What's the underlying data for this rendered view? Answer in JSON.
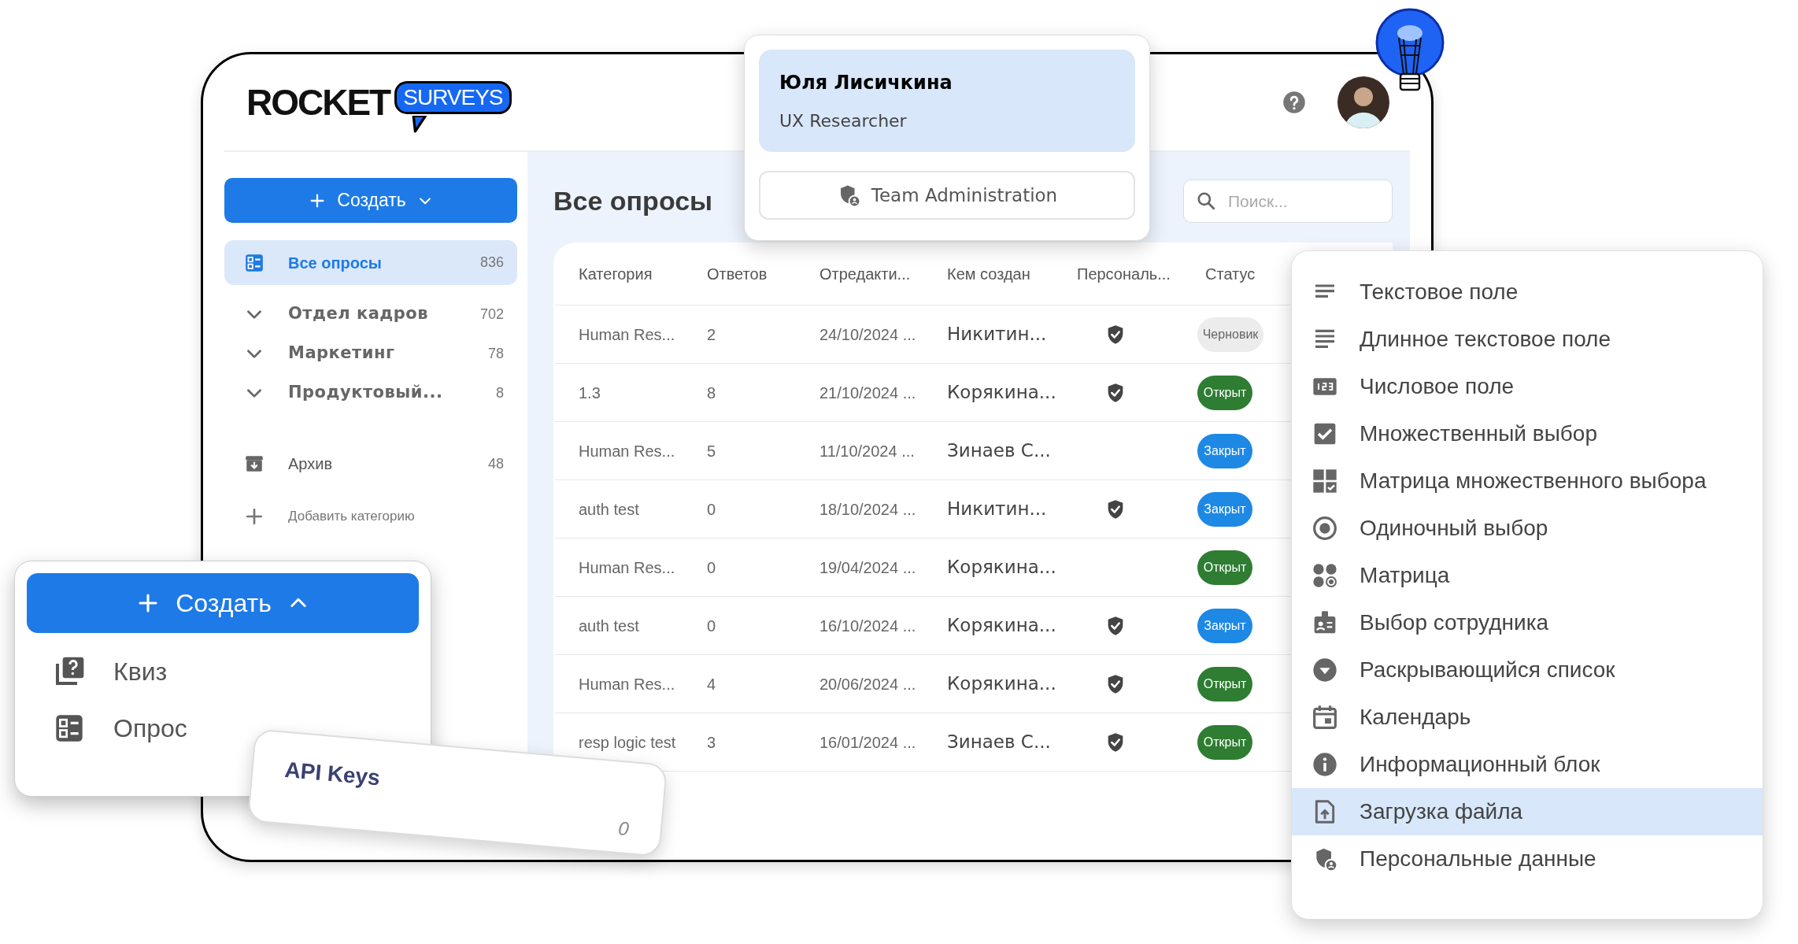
{
  "logo": {
    "word": "ROCKET",
    "badge": "SURVEYS"
  },
  "sidebar": {
    "create_button": {
      "label": "Создать",
      "expanded": false
    },
    "items": [
      {
        "kind": "all",
        "label": "Все опросы",
        "count": "836",
        "selected": true
      },
      {
        "kind": "folder",
        "label": "Отдел кадров",
        "count": "702",
        "selected": false
      },
      {
        "kind": "folder",
        "label": "Маркетинг",
        "count": "78",
        "selected": false
      },
      {
        "kind": "folder",
        "label": "Продуктовый...",
        "count": "8",
        "selected": false
      },
      {
        "kind": "archive",
        "label": "Архив",
        "count": "48",
        "selected": false
      }
    ],
    "add_category": "Добавить категорию"
  },
  "page_title": "Все опросы",
  "search": {
    "placeholder": "Поиск..."
  },
  "table": {
    "columns": [
      "Категория",
      "Ответов",
      "Отредакти...",
      "Кем создан",
      "Персональ...",
      "Статус"
    ],
    "rows": [
      {
        "cells": [
          "Human Res...",
          "2",
          "24/10/2024 ...",
          "Никитин..."
        ],
        "personal": true,
        "status": {
          "label": "Черновик",
          "kind": "draft"
        }
      },
      {
        "cells": [
          "1.3",
          "8",
          "21/10/2024 ...",
          "Корякина..."
        ],
        "personal": true,
        "status": {
          "label": "Открыт",
          "kind": "open"
        }
      },
      {
        "cells": [
          "Human Res...",
          "5",
          "11/10/2024 ...",
          "Зинаев С..."
        ],
        "personal": false,
        "status": {
          "label": "Закрыт",
          "kind": "closed"
        }
      },
      {
        "cells": [
          "auth test",
          "0",
          "18/10/2024 ...",
          "Никитин..."
        ],
        "personal": true,
        "status": {
          "label": "Закрыт",
          "kind": "closed"
        }
      },
      {
        "cells": [
          "Human Res...",
          "0",
          "19/04/2024 ...",
          "Корякина..."
        ],
        "personal": false,
        "status": {
          "label": "Открыт",
          "kind": "open"
        }
      },
      {
        "cells": [
          "auth test",
          "0",
          "16/10/2024 ...",
          "Корякина..."
        ],
        "personal": true,
        "status": {
          "label": "Закрыт",
          "kind": "closed"
        }
      },
      {
        "cells": [
          "Human Res...",
          "4",
          "20/06/2024 ...",
          "Корякина..."
        ],
        "personal": true,
        "status": {
          "label": "Открыт",
          "kind": "open"
        }
      },
      {
        "cells": [
          "resp logic test",
          "3",
          "16/01/2024 ...",
          "Зинаев С..."
        ],
        "personal": true,
        "status": {
          "label": "Открыт",
          "kind": "open"
        }
      }
    ]
  },
  "profile_card": {
    "name": "Юля Лисичкина",
    "role": "UX Researcher",
    "button": "Team Administration"
  },
  "field_menu": {
    "items": [
      {
        "kind": "short_text",
        "label": "Текстовое поле",
        "selected": false
      },
      {
        "kind": "long_text",
        "label": "Длинное текстовое поле",
        "selected": false
      },
      {
        "kind": "number",
        "label": "Числовое поле",
        "selected": false
      },
      {
        "kind": "checkbox",
        "label": "Множественный выбор",
        "selected": false
      },
      {
        "kind": "grid_check",
        "label": "Матрица множественного выбора",
        "selected": false
      },
      {
        "kind": "radio",
        "label": "Одиночный выбор",
        "selected": false
      },
      {
        "kind": "matrix",
        "label": "Матрица",
        "selected": false
      },
      {
        "kind": "employee",
        "label": "Выбор сотрудника",
        "selected": false
      },
      {
        "kind": "dropdown",
        "label": "Раскрывающийся список",
        "selected": false
      },
      {
        "kind": "calendar",
        "label": "Календарь",
        "selected": false
      },
      {
        "kind": "info",
        "label": "Информационный блок",
        "selected": false
      },
      {
        "kind": "upload",
        "label": "Загрузка файла",
        "selected": true
      },
      {
        "kind": "personal",
        "label": "Персональные данные",
        "selected": false
      }
    ]
  },
  "create_menu": {
    "button": {
      "label": "Создать",
      "expanded": true
    },
    "items": [
      {
        "kind": "quiz",
        "label": "Квиз"
      },
      {
        "kind": "survey",
        "label": "Опрос"
      }
    ]
  },
  "api_card": {
    "title": "API Keys",
    "count": "0"
  }
}
